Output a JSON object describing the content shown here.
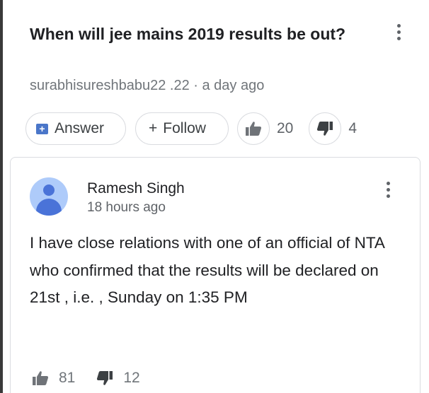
{
  "question": {
    "title": "When will jee mains 2019 results be out?",
    "meta": "surabhisureshbabu22 .22 · a day ago",
    "answer_label": "Answer",
    "follow_label": "Follow",
    "upvotes": "20",
    "downvotes": "4"
  },
  "answer": {
    "author": "Ramesh Singh",
    "time": "18 hours ago",
    "text": "I have close relations with one of an official of NTA who confirmed that the results will be declared on 21st , i.e. , Sunday on 1:35 PM",
    "upvotes": "81",
    "downvotes": "12"
  },
  "colors": {
    "accent": "#4a76c9",
    "avatar_bg": "#aecbfa",
    "avatar_fg": "#4a73d8",
    "border": "#dadce0"
  },
  "icons": {
    "answer": "answer-plus-icon",
    "follow": "plus-icon",
    "upvote": "thumbs-up-icon",
    "downvote": "thumbs-down-icon",
    "more": "more-vertical-icon"
  }
}
